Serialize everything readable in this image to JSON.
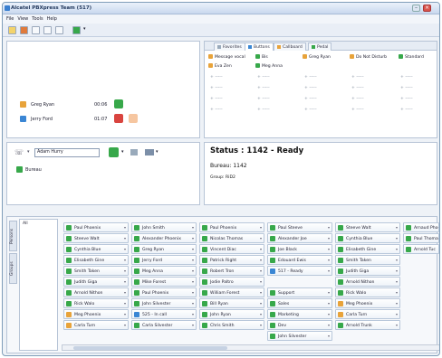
{
  "window": {
    "title": "Alcatel PBXpress Team (517)",
    "min": "–",
    "close": "×"
  },
  "menu": [
    "File",
    "View",
    "Tools",
    "Help"
  ],
  "colors": {
    "green": "#37a84a",
    "orange": "#e8a33a",
    "red": "#d9443f",
    "blue": "#3a86d4",
    "title": "#243a5e"
  },
  "calls": [
    {
      "name": "Greg Ryan",
      "time": "00:06",
      "icon": "orange-phone-icon",
      "actions": [
        "green-answer-icon"
      ]
    },
    {
      "name": "Jerry Ford",
      "time": "01:07",
      "icon": "blue-phone-icon",
      "actions": [
        "red-hangup-icon",
        "orange-transfer-icon"
      ]
    }
  ],
  "keys_panel": {
    "tabs": [
      "Favorites",
      "Buttons",
      "Callboard",
      "Pedal"
    ],
    "active_tab": 1,
    "cells": [
      [
        "Message vocal",
        "Bis",
        "Greg Ryan",
        "Do Not Disturb",
        "Standard"
      ],
      [
        "Eva Zen",
        "Meg Anna",
        "",
        "",
        ""
      ]
    ],
    "plus": "+",
    "dash": "-----"
  },
  "search": {
    "value": "Adam Hurry",
    "bureau_label": "Bureau"
  },
  "status": {
    "title": "Status : 1142 - Ready",
    "bureau": "Bureau: 1142",
    "group": "Group: RiD2"
  },
  "directory": {
    "vtabs": [
      "Persons",
      "Groups"
    ],
    "filter": "All",
    "columns": [
      [
        "Paul Phoenix",
        "Steeve Walt",
        "Cynthia Blue",
        "Elisabeth Gine",
        "Smith Taken",
        "Judith Giga",
        "Arnold Nithon",
        "Rick Walo",
        "Meg Phoenix",
        "Carla Turn"
      ],
      [
        "John Smith",
        "Alexander Phoenix",
        "Greg Ryan",
        "Jerry Ford",
        "Meg Anna",
        "Mike Forest",
        "Paul Phoenix",
        "John Silvester",
        "525 - In call",
        "Carla Silvester"
      ],
      [
        "Paul Phoenix",
        "Nicolas Thomas",
        "Vincent Diac",
        "Patrick Right",
        "Robert Tron",
        "Jodie Paltro",
        "William Forest",
        "Bill Ryan",
        "John Ryan",
        "Chris Smith"
      ],
      [
        "Paul Steeve",
        "Alexander Joe",
        "Joe Black",
        "Edouard Ewis",
        "517 - Ready",
        "",
        "Support",
        "Sales",
        "Marketing",
        "Dev",
        "John Silvester"
      ],
      [
        "Steeve Walt",
        "Cynthia Blue",
        "Elisabeth Gine",
        "Smith Taken",
        "Judith Giga",
        "Arnold Nithon",
        "Rick Walo",
        "Meg Phoenix",
        "Carla Turn",
        "Arnold Trunk"
      ],
      [
        "Arnaud Phoenix",
        "Paul Thomas",
        "Arnold Tuc"
      ]
    ]
  }
}
